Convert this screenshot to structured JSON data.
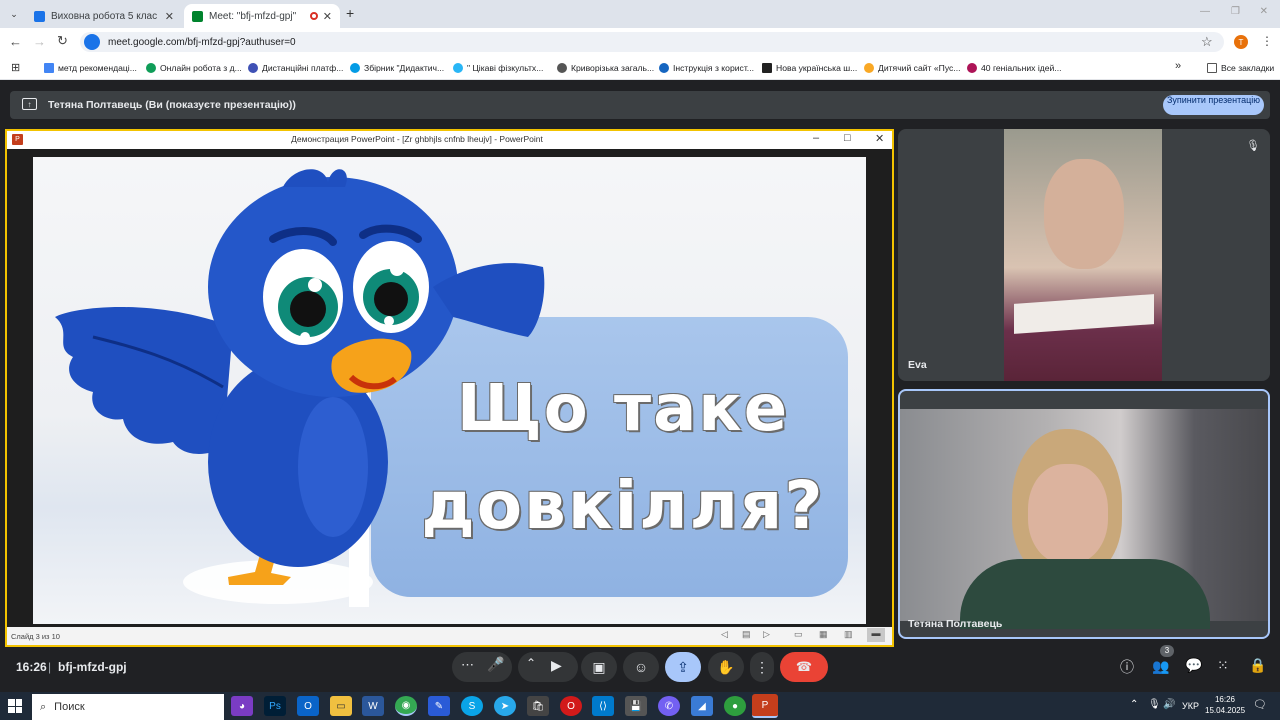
{
  "browser": {
    "tabs": [
      {
        "title": "Виховна робота 5 клас"
      },
      {
        "title": "Meet: \"bfj-mfzd-gpj\""
      }
    ],
    "url": "meet.google.com/bfj-mfzd-gpj?authuser=0",
    "profile_initial": "T",
    "bookmarks": [
      "метд рекомендаці...",
      "Онлайн робота з д...",
      "Дистанційні платф...",
      "Збірник \"Дидактич...",
      "\" Цікаві фізкультх...",
      "Криворізька загаль...",
      "Інструкція з корист...",
      "Нова українська ш...",
      "Дитячий сайт «Пус...",
      "40 геніальних ідей..."
    ],
    "all_bookmarks": "Все закладки"
  },
  "meet": {
    "presenting_text": "Тетяна Полтавець (Ви (показуєте презентацію))",
    "stop_button": "Зупинити презентацію",
    "time": "16:26",
    "meeting_code": "bfj-mfzd-gpj",
    "participant_count": "3",
    "participants": [
      {
        "name": "Eva"
      },
      {
        "name": "Тетяна Полтавець"
      }
    ]
  },
  "ppt": {
    "window_title": "Демонстрация PowerPoint - [Zr ghbhjls cnfnb lheujv] - PowerPoint",
    "slide_status": "Слайд 3 из 10",
    "slide_title_line1": "Що таке",
    "slide_title_line2": "довкілля?"
  },
  "taskbar": {
    "search": "Поиск",
    "lang": "УКР",
    "time": "16:26",
    "date": "15.04.2025"
  },
  "colors": {
    "meet_bg": "#202124",
    "end_call": "#ea4335",
    "present_active": "#a8c7fa",
    "ppt_border": "#f3c300",
    "bird_blue": "#1f4fc0"
  }
}
